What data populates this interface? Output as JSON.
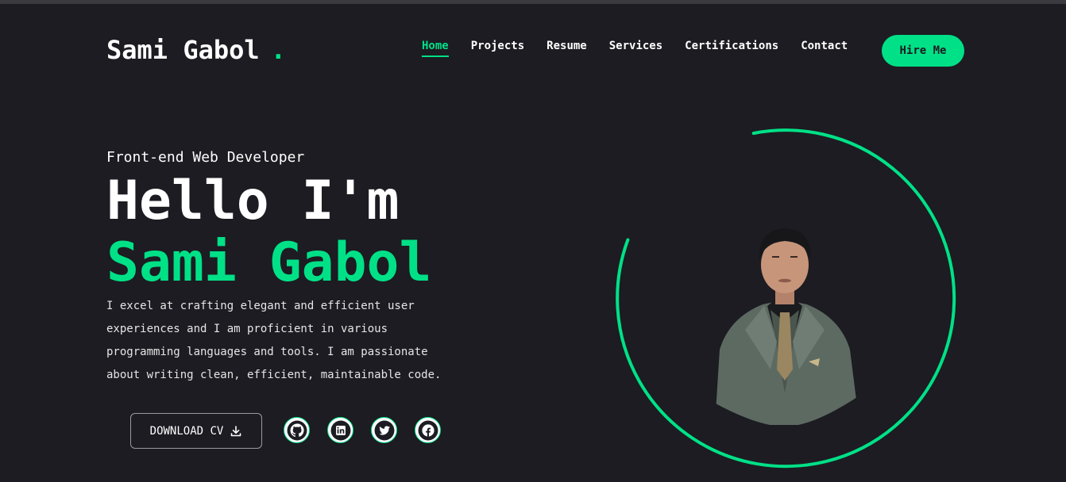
{
  "header": {
    "logo_text": "Sami Gabol",
    "logo_dot": ".",
    "nav": [
      {
        "label": "Home",
        "active": true
      },
      {
        "label": "Projects",
        "active": false
      },
      {
        "label": "Resume",
        "active": false
      },
      {
        "label": "Services",
        "active": false
      },
      {
        "label": "Certifications",
        "active": false
      },
      {
        "label": "Contact",
        "active": false
      }
    ],
    "hire_label": "Hire Me"
  },
  "hero": {
    "role": "Front-end Web Developer",
    "greeting": "Hello I'm",
    "name": "Sami Gabol",
    "description": "I excel at crafting elegant and efficient user experiences and I am proficient in various programming languages and tools. I am passionate about writing clean, efficient, maintainable code.",
    "cv_label": "DOWNLOAD CV",
    "socials": [
      "github-icon",
      "linkedin-icon",
      "twitter-icon",
      "facebook-icon"
    ]
  },
  "colors": {
    "accent": "#00e187",
    "background": "#1c1c22"
  }
}
